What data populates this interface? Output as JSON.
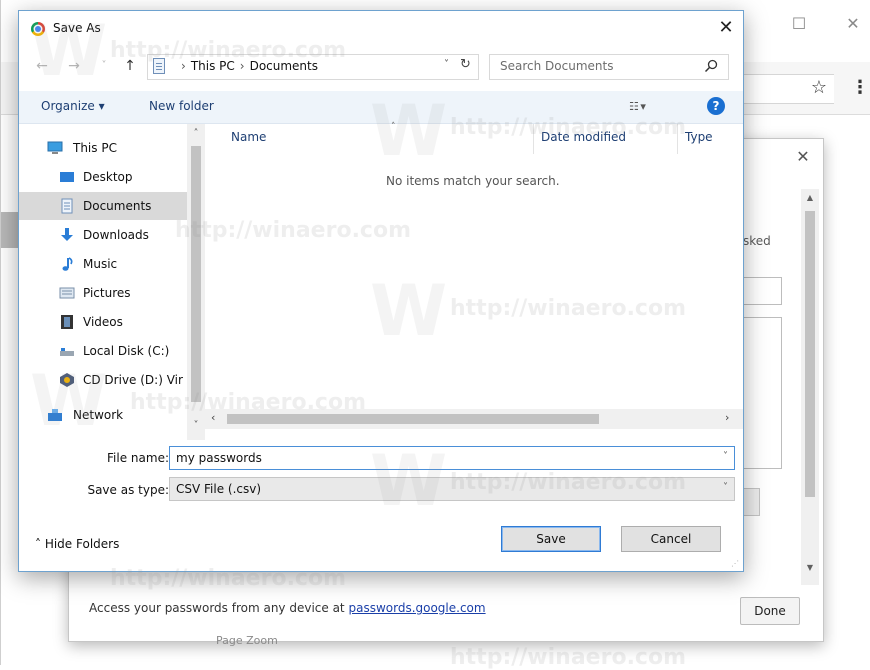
{
  "background_window": {
    "star_icon": "star-icon",
    "menu_icon": "kebab-icon"
  },
  "password_dialog": {
    "asked_text": "sked",
    "footer_text": "Access your passwords from any device at",
    "footer_link": "passwords.google.com",
    "done_label": "Done",
    "below_text": "Page Zoom"
  },
  "save_as": {
    "title": "Save As",
    "address": {
      "segments": [
        "This PC",
        "Documents"
      ]
    },
    "search_placeholder": "Search Documents",
    "commands": {
      "organize": "Organize ▾",
      "new_folder": "New folder"
    },
    "nav_items": [
      {
        "label": "This PC",
        "icon": "this-pc-icon"
      },
      {
        "label": "Desktop",
        "icon": "desktop-icon"
      },
      {
        "label": "Documents",
        "icon": "documents-icon",
        "selected": true
      },
      {
        "label": "Downloads",
        "icon": "downloads-icon"
      },
      {
        "label": "Music",
        "icon": "music-icon"
      },
      {
        "label": "Pictures",
        "icon": "pictures-icon"
      },
      {
        "label": "Videos",
        "icon": "videos-icon"
      },
      {
        "label": "Local Disk (C:)",
        "icon": "local-disk-icon"
      },
      {
        "label": "CD Drive (D:) Vir",
        "icon": "cd-drive-icon"
      },
      {
        "label": "Network",
        "icon": "network-icon"
      }
    ],
    "columns": [
      "Name",
      "Date modified",
      "Type"
    ],
    "empty_message": "No items match your search.",
    "file_name_label": "File name:",
    "file_name_value": "my passwords",
    "save_type_label": "Save as type:",
    "save_type_value": "CSV File (.csv)",
    "hide_folders": "Hide Folders",
    "save_label": "Save",
    "cancel_label": "Cancel"
  },
  "watermark": "http://winaero.com",
  "colors": {
    "accent": "#1a6fd1",
    "dialog_border": "#6ea2cf",
    "link": "#1a3fa8"
  }
}
